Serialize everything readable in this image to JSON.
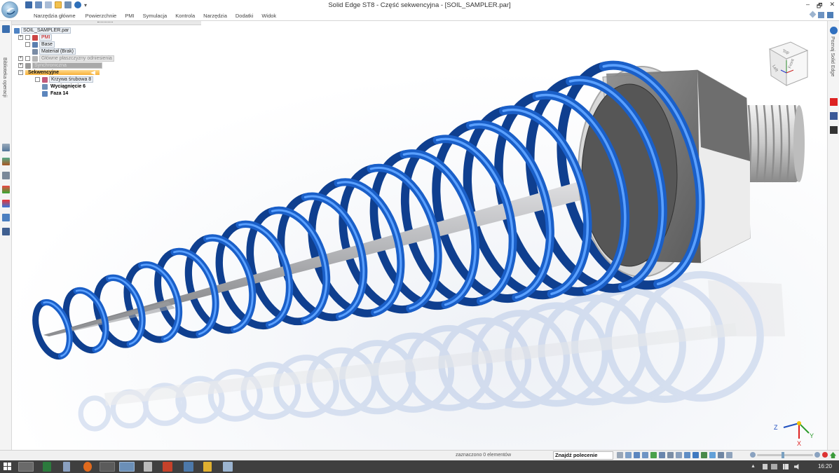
{
  "window": {
    "title": "Solid Edge ST8 - Część sekwencyjna - [SOIL_SAMPLER.par]",
    "buttons": [
      "–",
      "🗗",
      "✕"
    ]
  },
  "ribbon": {
    "tabs": [
      "Narzędzia główne",
      "Powierzchnie",
      "PMI",
      "Symulacja",
      "Kontrola",
      "Narzędzia",
      "Dodatki",
      "Widok"
    ]
  },
  "left_rail": {
    "label": "Biblioteka operacji"
  },
  "right_rail": {
    "label": "Poznaj Solid Edge"
  },
  "tree": {
    "root": "SOIL_SAMPLER.par",
    "pmi": "PMI",
    "base": "Base",
    "material": "Materiał (Brak)",
    "planes": "Główne płaszczyzny odniesienia",
    "sync": "Synchroniczna",
    "sequential": "Sekwencyjne",
    "helix": "Krzywa śrubowa 8",
    "extrude": "Wyciągnięcie 6",
    "chamfer": "Faza 14"
  },
  "view_cube": {
    "faces": [
      "Top",
      "Left",
      "Front"
    ]
  },
  "triad": {
    "axes": [
      "Z",
      "Y",
      "X"
    ]
  },
  "status": {
    "selection": "zaznaczono 0 elementów",
    "command_finder": "Znajdź polecenie"
  },
  "taskbar": {
    "clock": "16:20"
  },
  "colors": {
    "spring": "#1a5fc8",
    "spring_light": "#5aa0ff",
    "accent_selected": "#f7b13a",
    "taskbar": "#3f3f3f"
  }
}
